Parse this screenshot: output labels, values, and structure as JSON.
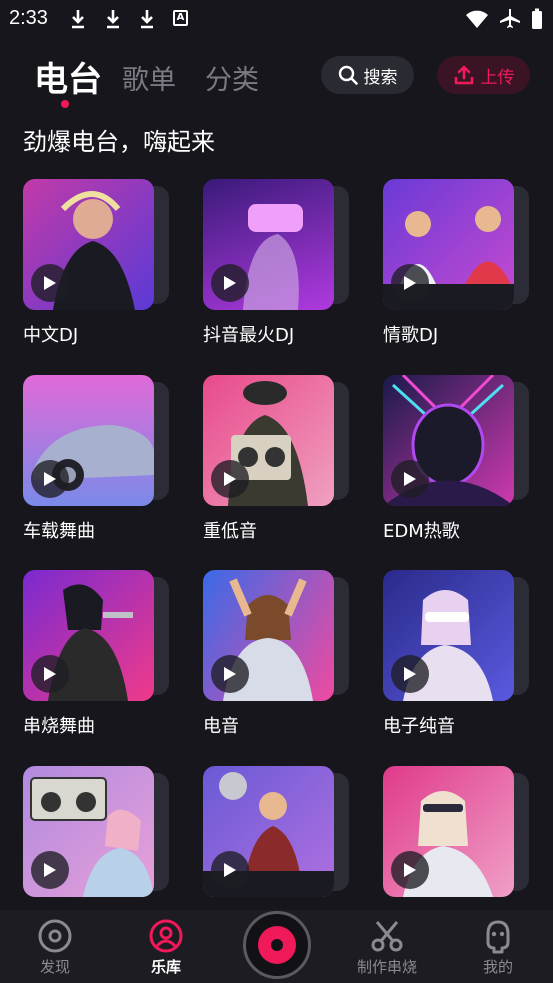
{
  "status_bar": {
    "time": "2:33",
    "left_icons": [
      "download-icon",
      "download-icon",
      "download-icon",
      "a-icon"
    ],
    "a_icon_glyph": "A",
    "right_icons": [
      "wifi-icon",
      "airplane-icon",
      "battery-icon"
    ]
  },
  "header": {
    "tabs": [
      {
        "label": "电台",
        "active": true
      },
      {
        "label": "歌单",
        "active": false
      },
      {
        "label": "分类",
        "active": false
      }
    ],
    "search_label": "搜索",
    "upload_label": "上传"
  },
  "section_title": "劲爆电台，嗨起来",
  "cards": [
    {
      "label": "中文DJ",
      "g1": "#c23aa8",
      "g2": "#5a3ad6"
    },
    {
      "label": "抖音最火DJ",
      "g1": "#3a1a7a",
      "g2": "#b03ae0"
    },
    {
      "label": "情歌DJ",
      "g1": "#6a3ad6",
      "g2": "#c84ad0"
    },
    {
      "label": "车载舞曲",
      "g1": "#e06ad8",
      "g2": "#7a8ae8"
    },
    {
      "label": "重低音",
      "g1": "#e84a8a",
      "g2": "#f0a0c0"
    },
    {
      "label": "EDM热歌",
      "g1": "#1a1a4a",
      "g2": "#d03ab0"
    },
    {
      "label": "串烧舞曲",
      "g1": "#7a2ad0",
      "g2": "#f03a8a"
    },
    {
      "label": "电音",
      "g1": "#3a6ae8",
      "g2": "#f04aa0"
    },
    {
      "label": "电子纯音",
      "g1": "#2a2a8a",
      "g2": "#5a5ae0"
    },
    {
      "label": "",
      "g1": "#b08ae0",
      "g2": "#e8a0d8"
    },
    {
      "label": "",
      "g1": "#6a5ad6",
      "g2": "#b070e0"
    },
    {
      "label": "",
      "g1": "#e03a8a",
      "g2": "#f0a0c8"
    }
  ],
  "bottom_nav": [
    {
      "label": "发现",
      "icon": "disc-icon",
      "active": false
    },
    {
      "label": "乐库",
      "icon": "library-icon",
      "active": true
    },
    {
      "label": "制作串烧",
      "icon": "scissors-icon",
      "active": false
    },
    {
      "label": "我的",
      "icon": "profile-icon",
      "active": false
    }
  ],
  "colors": {
    "accent": "#f0195a",
    "background": "#16161c"
  }
}
